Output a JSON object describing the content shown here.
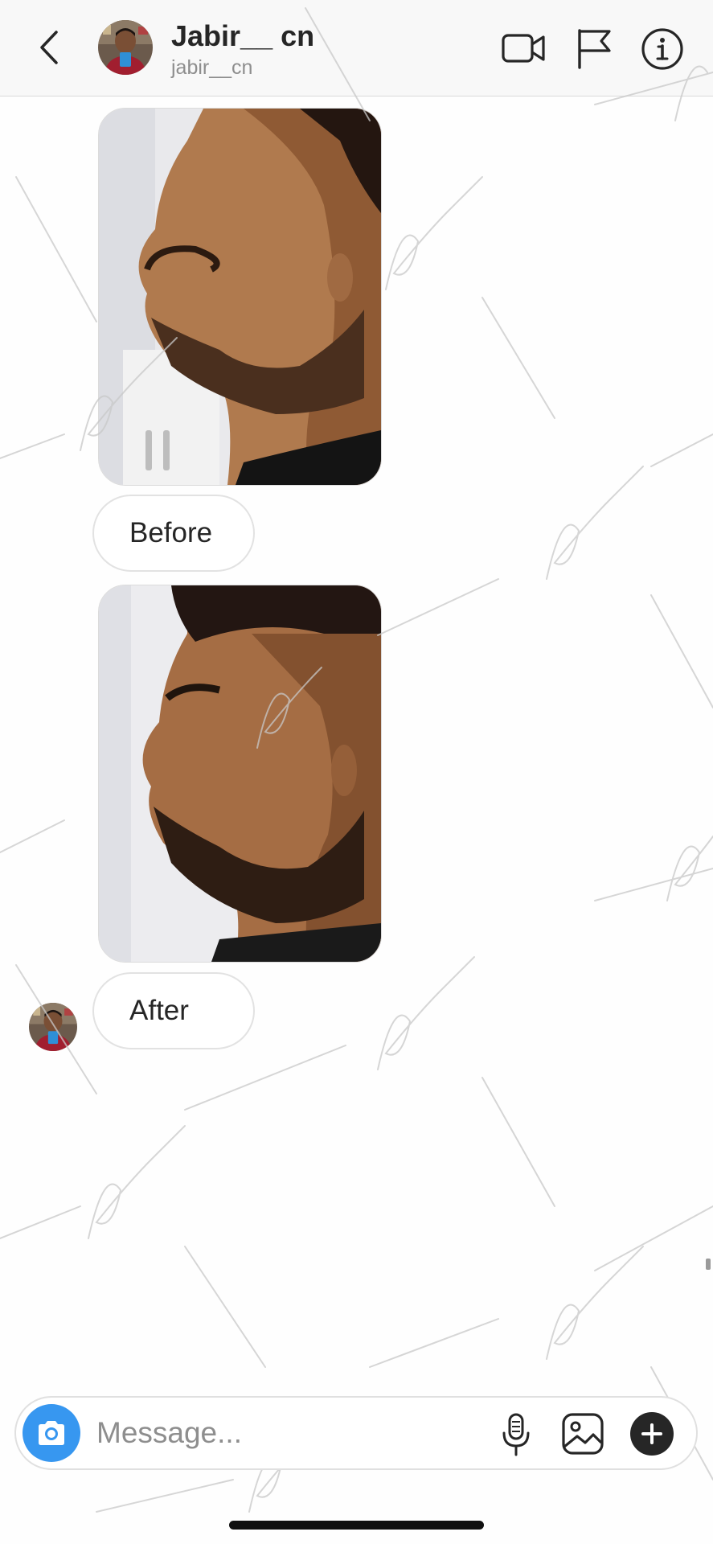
{
  "header": {
    "back_icon": "chevron-left-icon",
    "display_name": "Jabir__ cn",
    "username": "jabir__cn",
    "video_call_icon": "video-camera-icon",
    "report_icon": "flag-icon",
    "info_icon": "info-icon"
  },
  "messages": [
    {
      "type": "image",
      "content": "side profile photo (before)"
    },
    {
      "type": "text",
      "text": "Before"
    },
    {
      "type": "image",
      "content": "side profile photo (after)"
    },
    {
      "type": "text",
      "text": "After"
    }
  ],
  "composer": {
    "camera_icon": "camera-icon",
    "placeholder": "Message...",
    "mic_icon": "microphone-icon",
    "gallery_icon": "gallery-icon",
    "more_icon": "plus-icon"
  },
  "colors": {
    "accent": "#3797f0",
    "text_primary": "#262626",
    "text_secondary": "#8e8e8e",
    "header_bg": "#f8f8f8",
    "bubble_border": "#e2e2e2"
  }
}
